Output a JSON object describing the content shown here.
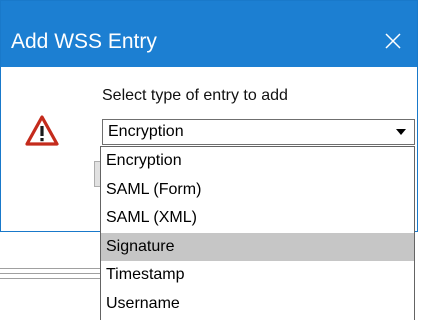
{
  "dialog": {
    "title": "Add WSS Entry",
    "close_glyph": "✕",
    "prompt": "Select type of entry to add",
    "selected_value": "Encryption",
    "icons": {
      "warning": "warning-icon",
      "close": "close-icon",
      "dropdown": "chevron-down-icon"
    }
  },
  "dropdown": {
    "options": [
      {
        "label": "Encryption",
        "selected": false
      },
      {
        "label": "SAML (Form)",
        "selected": false
      },
      {
        "label": "SAML (XML)",
        "selected": false
      },
      {
        "label": "Signature",
        "selected": true
      },
      {
        "label": "Timestamp",
        "selected": false
      },
      {
        "label": "Username",
        "selected": false
      }
    ]
  },
  "colors": {
    "title_bar": "#1c7fd2",
    "highlight": "#c6c6c6",
    "warning_red": "#c42b1c"
  }
}
